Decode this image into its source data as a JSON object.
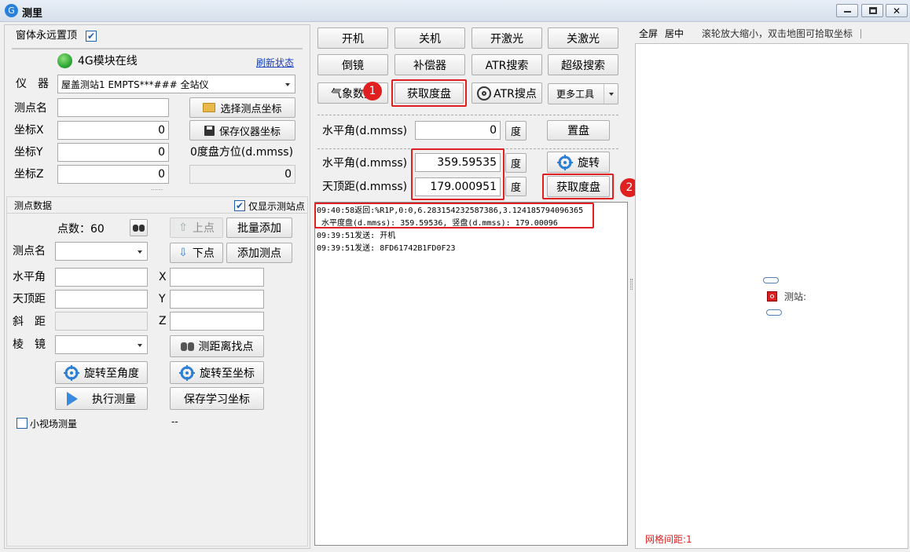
{
  "window": {
    "title": "测里"
  },
  "left": {
    "topmost_label": "窗体永远置顶",
    "module_status": "4G模块在线",
    "refresh_link": "刷新状态",
    "instrument_label": "仪　器",
    "instrument_value": "屋盖测站1 EMPTS***### 全站仪",
    "point_name_label": "测点名",
    "point_name_value": "",
    "select_point_btn": "选择测点坐标",
    "x_label": "坐标X",
    "x_value": "0",
    "save_instr_btn": "保存仪器坐标",
    "y_label": "坐标Y",
    "y_value": "0",
    "zero_azimuth_label": "0度盘方位(d.mmss)",
    "z_label": "坐标Z",
    "z_value": "0",
    "zero_azimuth_value": "0",
    "grip": "......",
    "points_section": "测点数据",
    "only_show_label": "仅显示测站点",
    "count_label": "点数：60",
    "up_btn": "上点",
    "batch_add_btn": "批量添加",
    "pt_name_label": "测点名",
    "down_btn": "下点",
    "add_point_btn": "添加测点",
    "hz_label": "水平角",
    "zen_label": "天顶距",
    "slope_label": "斜　距",
    "prism_label": "棱　镜",
    "X": "X",
    "Y": "Y",
    "Z": "Z",
    "find_point_btn": "测距离找点",
    "rotate_angle_btn": "旋转至角度",
    "rotate_coord_btn": "旋转至坐标",
    "measure_btn": "执行测量",
    "save_learn_btn": "保存学习坐标",
    "small_fov_label": "小视场测量",
    "dash": "--"
  },
  "mid": {
    "btn_on": "开机",
    "btn_off": "关机",
    "btn_laser_on": "开激光",
    "btn_laser_off": "关激光",
    "btn_flip": "倒镜",
    "btn_comp": "补偿器",
    "btn_atr_search": "ATR搜索",
    "btn_super": "超级搜索",
    "btn_weather": "气象数据",
    "btn_get_disk": "获取度盘",
    "btn_atr_point": "ATR搜点",
    "btn_more": "更多工具",
    "hz_set_label": "水平角(d.mmss)",
    "hz_set_value": "0",
    "deg1": "度",
    "btn_set_disk": "置盘",
    "hz_label": "水平角(d.mmss)",
    "hz_value": "359.59535",
    "deg2": "度",
    "btn_rotate": "旋转",
    "zen_label": "天顶距(d.mmss)",
    "zen_value": "179.000951",
    "deg3": "度",
    "btn_get_disk2": "获取度盘",
    "badge1": "1",
    "badge2": "2",
    "log": [
      "09:40:58返回:%R1P,0:0,6.283154232587386,3.124185794096365",
      "水平度盘(d.mmss): 359.59536, 竖盘(d.mmss): 179.00096",
      "09:39:51发送: 开机",
      "09:39:51发送: 8FD61742B1FD0F23"
    ]
  },
  "map": {
    "fullscreen": "全屏",
    "center": "居中",
    "hint": "滚轮放大缩小，双击地图可拾取坐标",
    "station_label": "测站:",
    "grid_label": "网格间距:1"
  },
  "colors": {
    "accent_red": "#e02020",
    "status_green": "#2ea836",
    "icon_blue": "#2c7fd6"
  }
}
